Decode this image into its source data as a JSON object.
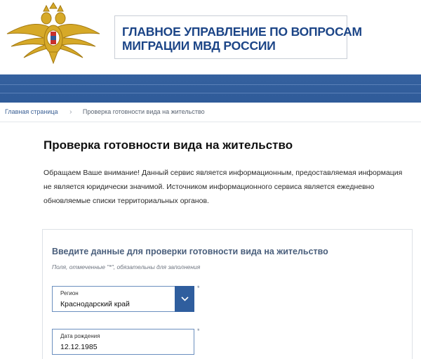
{
  "header": {
    "title_line1": "ГЛАВНОЕ УПРАВЛЕНИЕ ПО ВОПРОСАМ",
    "title_line2": "МИГРАЦИИ МВД РОССИИ",
    "emblem_icon": "double-headed-eagle-emblem-icon"
  },
  "colors": {
    "brand_blue": "#2f5b99",
    "title_blue": "#1c4587",
    "field_border": "#6b8fbf"
  },
  "breadcrumb": {
    "home": "Главная страница",
    "separator": "›",
    "current": "Проверка готовности вида на жительство"
  },
  "page": {
    "title": "Проверка готовности вида на жительство",
    "notice_line1": "Обращаем Ваше внимание! Данный сервис является информационным, предоставляемая информация",
    "notice_line2": "не является юридически значимой. Источником информационного сервиса является ежедневно",
    "notice_line3": "обновляемые списки территориальных органов."
  },
  "form": {
    "heading": "Введите данные для проверки готовности вида на жительство",
    "hint": "Поля, отмеченные \"*\", обязательны для заполнения",
    "required_mark": "*",
    "region": {
      "label": "Регион",
      "value": "Краснодарский край"
    },
    "birthdate": {
      "label": "Дата рождения",
      "value": "12.12.1985"
    }
  }
}
